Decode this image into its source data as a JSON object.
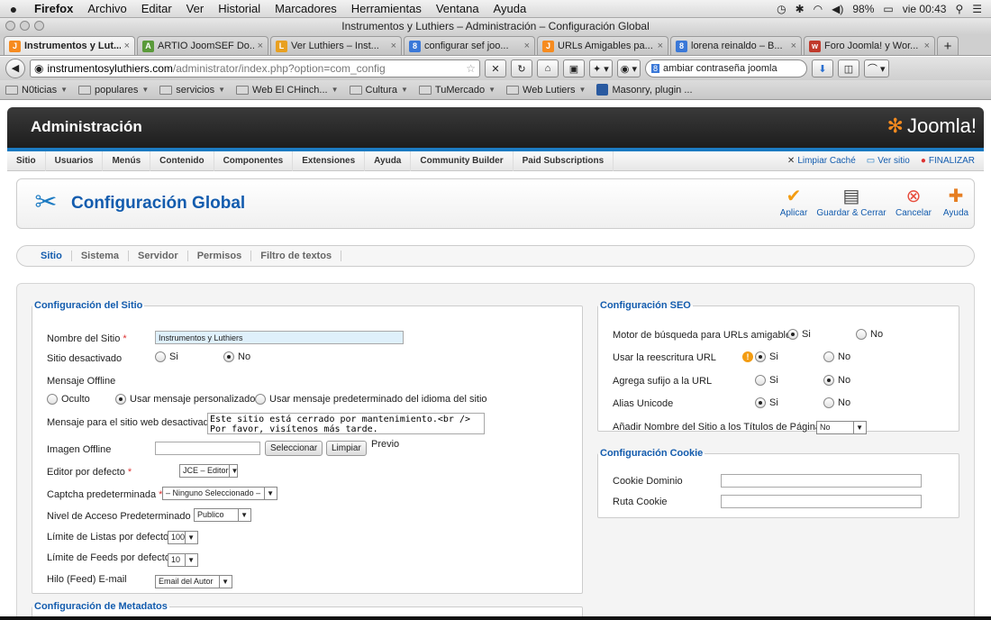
{
  "os_menu": {
    "apple": "",
    "items": [
      "Firefox",
      "Archivo",
      "Editar",
      "Ver",
      "Historial",
      "Marcadores",
      "Herramientas",
      "Ventana",
      "Ayuda"
    ],
    "battery": "98%",
    "clock": "vie 00:43"
  },
  "window": {
    "title": "Instrumentos y Luthiers – Administración – Configuración Global"
  },
  "browser_tabs": [
    {
      "label": "Instrumentos y Lut...",
      "fav": "J",
      "color": "#f68b1f"
    },
    {
      "label": "ARTIO JoomSEF Do...",
      "fav": "A",
      "color": "#5a9a3a"
    },
    {
      "label": "Ver Luthiers – Inst...",
      "fav": "L",
      "color": "#e8a020"
    },
    {
      "label": "configurar sef joo...",
      "fav": "8",
      "color": "#3a78d8"
    },
    {
      "label": "URLs Amigables pa...",
      "fav": "J",
      "color": "#f68b1f"
    },
    {
      "label": "lorena reinaldo – B...",
      "fav": "8",
      "color": "#3a78d8"
    },
    {
      "label": "Foro Joomla! y Wor...",
      "fav": "w",
      "color": "#c0392b"
    }
  ],
  "tab_close": "×",
  "tab_new": "+",
  "nav": {
    "url_host": "instrumentosyluthiers.com",
    "url_path": "/administrator/index.php?option=com_config",
    "search_value": "ambiar contraseña joomla"
  },
  "bookmarks": [
    "N0ticias",
    "populares",
    "servicios",
    "Web El CHinch...",
    "Cultura",
    "TuMercado",
    "Web Lutiers",
    "Masonry, plugin ..."
  ],
  "admin": {
    "title": "Administración",
    "logo": "Joomla!",
    "menu": [
      "Sitio",
      "Usuarios",
      "Menús",
      "Contenido",
      "Componentes",
      "Extensiones",
      "Ayuda",
      "Community Builder",
      "Paid Subscriptions"
    ],
    "clear_cache": "Limpiar Caché",
    "view_site": "Ver sitio",
    "logout": "FINALIZAR"
  },
  "toolbar": {
    "title": "Configuración Global",
    "apply": "Aplicar",
    "save_close": "Guardar & Cerrar",
    "cancel": "Cancelar",
    "help": "Ayuda"
  },
  "subtabs": [
    "Sitio",
    "Sistema",
    "Servidor",
    "Permisos",
    "Filtro de textos"
  ],
  "site_config": {
    "legend": "Configuración del Sitio",
    "site_name_label": "Nombre del Sitio",
    "site_name_value": "Instrumentos y Luthiers",
    "offline_label": "Sitio desactivado",
    "yes": "Si",
    "no": "No",
    "offline_msg_label": "Mensaje Offline",
    "opt_hidden": "Oculto",
    "opt_custom": "Usar mensaje personalizado",
    "opt_default": "Usar mensaje predeterminado del idioma del sitio",
    "offline_text_label": "Mensaje para el sitio web desactivado",
    "offline_text_value": "Este sitio está cerrado por mantenimiento.<br />\nPor favor, visítenos más tarde.",
    "offline_image_label": "Imagen Offline",
    "select_btn": "Seleccionar",
    "clear_btn": "Limpiar",
    "preview": "Previo",
    "editor_label": "Editor por defecto",
    "editor_value": "JCE – Editor",
    "captcha_label": "Captcha predeterminada",
    "captcha_value": "– Ninguno Seleccionado –",
    "access_label": "Nivel de Acceso Predeterminado",
    "access_value": "Publico",
    "list_limit_label": "Límite de Listas por defecto",
    "list_limit_value": "100",
    "feed_limit_label": "Límite de Feeds por defecto",
    "feed_limit_value": "10",
    "feed_email_label": "Hilo (Feed) E-mail",
    "feed_email_value": "Email del Autor"
  },
  "metadata": {
    "legend": "Configuración de Metadatos"
  },
  "seo": {
    "legend": "Configuración SEO",
    "sef_label": "Motor de búsqueda para URLs amigables",
    "rewrite_label": "Usar la reescritura URL",
    "suffix_label": "Agrega sufijo a la URL",
    "unicode_label": "Alias Unicode",
    "sitename_label": "Añadir Nombre del Sitio a los Títulos de Páginas",
    "sitename_value": "No",
    "yes": "Si",
    "no": "No"
  },
  "cookie": {
    "legend": "Configuración Cookie",
    "domain_label": "Cookie Dominio",
    "path_label": "Ruta Cookie"
  }
}
